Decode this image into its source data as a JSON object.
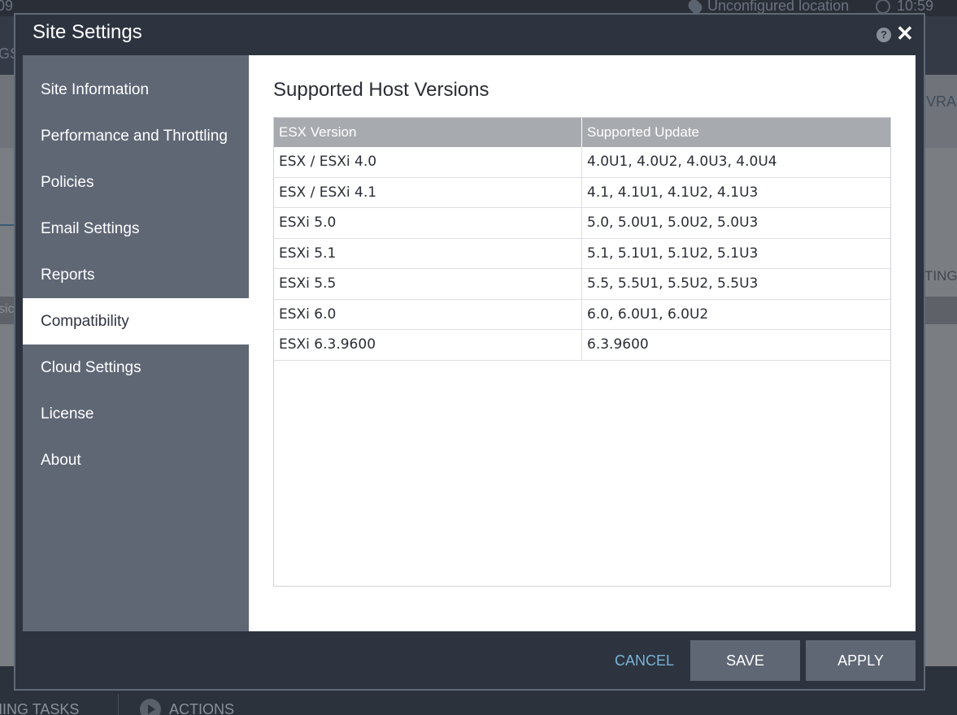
{
  "background": {
    "time_left": "09",
    "location": "Unconfigured location",
    "clock": "10:59",
    "nav_fragment": "GS",
    "side_fragment_1": "VRA",
    "side_fragment_2": "TINGS",
    "side_fragment_3": "sic",
    "bottom_tasks": "NING TASKS",
    "bottom_actions": "ACTIONS"
  },
  "modal": {
    "title": "Site Settings",
    "help_symbol": "?",
    "close_symbol": "✕"
  },
  "sidebar": {
    "items": [
      {
        "label": "Site Information"
      },
      {
        "label": "Performance and Throttling"
      },
      {
        "label": "Policies"
      },
      {
        "label": "Email Settings"
      },
      {
        "label": "Reports"
      },
      {
        "label": "Compatibility",
        "active": true
      },
      {
        "label": "Cloud Settings"
      },
      {
        "label": "License"
      },
      {
        "label": "About"
      }
    ]
  },
  "content": {
    "title": "Supported Host Versions",
    "columns": [
      "ESX Version",
      "Supported Update"
    ],
    "rows": [
      [
        "ESX / ESXi 4.0",
        "4.0U1, 4.0U2, 4.0U3, 4.0U4"
      ],
      [
        "ESX / ESXi 4.1",
        "4.1, 4.1U1, 4.1U2, 4.1U3"
      ],
      [
        "ESXi 5.0",
        "5.0, 5.0U1, 5.0U2, 5.0U3"
      ],
      [
        "ESXi 5.1",
        "5.1, 5.1U1, 5.1U2, 5.1U3"
      ],
      [
        "ESXi 5.5",
        "5.5, 5.5U1, 5.5U2, 5.5U3"
      ],
      [
        "ESXi 6.0",
        "6.0, 6.0U1, 6.0U2"
      ],
      [
        "ESXi 6.3.9600",
        "6.3.9600"
      ]
    ]
  },
  "footer": {
    "cancel_label": "CANCEL",
    "save_label": "SAVE",
    "apply_label": "APPLY"
  },
  "colors": {
    "accent_link": "#79b3d6",
    "sidebar_bg": "#5f6775",
    "modal_bg": "#2d3440",
    "table_header_bg": "#a7aaae"
  }
}
